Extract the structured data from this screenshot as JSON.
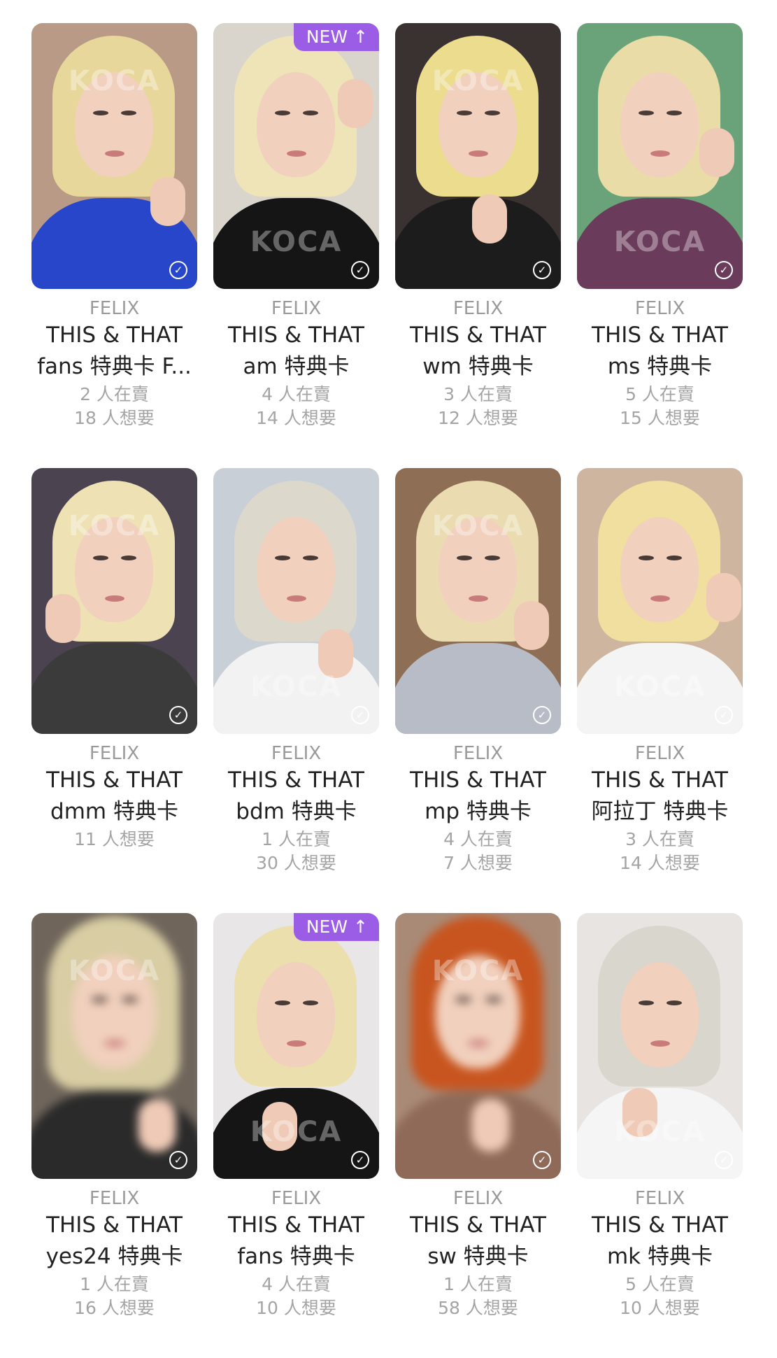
{
  "colors": {
    "badge": "#9b5de5",
    "member_text": "#9a9a9a",
    "title_text": "#222222",
    "stat_text": "#a4a4a4"
  },
  "cards": [
    {
      "member": "FELIX",
      "line1": "THIS & THAT",
      "line2": "fans 特典卡 F...",
      "selling": "2 人在賣",
      "wanting": "18 人想要",
      "badge": "",
      "blurred": false,
      "watermark": "KOCA",
      "check_icon": "check-circle-icon",
      "bg": "#b89a86",
      "hair": "#e8d79a",
      "shirt": "#2746c9"
    },
    {
      "member": "FELIX",
      "line1": "THIS & THAT",
      "line2": "am 特典卡",
      "selling": "4 人在賣",
      "wanting": "14 人想要",
      "badge": "NEW",
      "blurred": false,
      "watermark": "KOCA",
      "check_icon": "check-circle-icon",
      "bg": "#d9d4cc",
      "hair": "#efe4b8",
      "shirt": "#151515"
    },
    {
      "member": "FELIX",
      "line1": "THIS & THAT",
      "line2": "wm 特典卡",
      "selling": "3 人在賣",
      "wanting": "12 人想要",
      "badge": "",
      "blurred": false,
      "watermark": "KOCA",
      "check_icon": "check-circle-icon",
      "bg": "#3a3230",
      "hair": "#ecdc8e",
      "shirt": "#1c1c1c"
    },
    {
      "member": "FELIX",
      "line1": "THIS & THAT",
      "line2": "ms 特典卡",
      "selling": "5 人在賣",
      "wanting": "15 人想要",
      "badge": "",
      "blurred": false,
      "watermark": "KOCA",
      "check_icon": "check-circle-icon",
      "bg": "#6aa37a",
      "hair": "#e9dca6",
      "shirt": "#6a3b5a"
    },
    {
      "member": "FELIX",
      "line1": "THIS & THAT",
      "line2": "dmm 特典卡",
      "selling": "",
      "wanting": "11 人想要",
      "badge": "",
      "blurred": false,
      "watermark": "KOCA",
      "check_icon": "check-circle-icon",
      "bg": "#4b4450",
      "hair": "#eee2b4",
      "shirt": "#3b3b3b"
    },
    {
      "member": "FELIX",
      "line1": "THIS & THAT",
      "line2": "bdm 特典卡",
      "selling": "1 人在賣",
      "wanting": "30 人想要",
      "badge": "",
      "blurred": false,
      "watermark": "KOCA",
      "check_icon": "check-circle-icon",
      "bg": "#c9cfd6",
      "hair": "#dcd8cc",
      "shirt": "#f2f2f2"
    },
    {
      "member": "FELIX",
      "line1": "THIS & THAT",
      "line2": "mp 特典卡",
      "selling": "4 人在賣",
      "wanting": "7 人想要",
      "badge": "",
      "blurred": false,
      "watermark": "KOCA",
      "check_icon": "check-circle-icon",
      "bg": "#8e6f55",
      "hair": "#eadcb0",
      "shirt": "#b8bcc6"
    },
    {
      "member": "FELIX",
      "line1": "THIS & THAT",
      "line2": "阿拉丁 特典卡",
      "selling": "3 人在賣",
      "wanting": "14 人想要",
      "badge": "",
      "blurred": false,
      "watermark": "KOCA",
      "check_icon": "check-circle-icon",
      "bg": "#cdb59f",
      "hair": "#f0df9e",
      "shirt": "#f4f4f4"
    },
    {
      "member": "FELIX",
      "line1": "THIS & THAT",
      "line2": "yes24 特典卡",
      "selling": "1 人在賣",
      "wanting": "16 人想要",
      "badge": "",
      "blurred": true,
      "watermark": "KOCA",
      "check_icon": "check-circle-icon",
      "bg": "#6f655b",
      "hair": "#d8cda3",
      "shirt": "#2a2a2a"
    },
    {
      "member": "FELIX",
      "line1": "THIS & THAT",
      "line2": "fans 特典卡",
      "selling": "4 人在賣",
      "wanting": "10 人想要",
      "badge": "NEW",
      "blurred": false,
      "watermark": "KOCA",
      "check_icon": "check-circle-icon",
      "bg": "#e8e6e6",
      "hair": "#ecdfae",
      "shirt": "#151515"
    },
    {
      "member": "FELIX",
      "line1": "THIS & THAT",
      "line2": "sw 特典卡",
      "selling": "1 人在賣",
      "wanting": "58 人想要",
      "badge": "",
      "blurred": true,
      "watermark": "KOCA",
      "check_icon": "check-circle-icon",
      "bg": "#a98a76",
      "hair": "#c8551f",
      "shirt": "#8f6a58"
    },
    {
      "member": "FELIX",
      "line1": "THIS & THAT",
      "line2": "mk 特典卡",
      "selling": "5 人在賣",
      "wanting": "10 人想要",
      "badge": "",
      "blurred": false,
      "watermark": "KOCA",
      "check_icon": "check-circle-icon",
      "bg": "#e7e4e2",
      "hair": "#d9d6cd",
      "shirt": "#f5f5f5"
    }
  ]
}
